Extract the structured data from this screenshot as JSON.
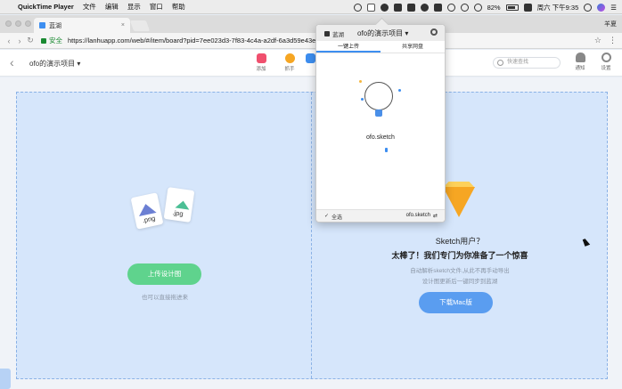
{
  "menubar": {
    "app_name": "QuickTime Player",
    "items": [
      "文件",
      "编辑",
      "显示",
      "窗口",
      "帮助"
    ],
    "battery": "82%",
    "clock": "周六 下午9:35",
    "apple_icon": "apple-icon"
  },
  "browser": {
    "tab_title": "蓝湖",
    "user_tag": "羊夏",
    "secure_label": "安全",
    "url": "https://lanhuapp.com/web/#/item/board?pid=7ee023d3-7f83-4c4a-a2df-6a3d59e43e"
  },
  "app": {
    "project_name": "ofo的演示项目",
    "tools": [
      {
        "label": "添加",
        "color": "#f0506e"
      },
      {
        "label": "抓手",
        "color": "#f6a623"
      }
    ],
    "search_placeholder": "快速查找",
    "notify_label": "通知",
    "settings_label": "设置"
  },
  "upload": {
    "file1_ext": ".png",
    "file2_ext": ".jpg",
    "upload_button": "上传设计图",
    "drag_hint": "也可以直接拖进来",
    "sketch_title": "Sketch用户？",
    "sketch_headline": "太棒了！我们专门为你准备了一个惊喜",
    "sketch_desc1": "自动解析sketch文件,从此不再手动导出",
    "sketch_desc2": "设计图更新后一键同步到蓝湖",
    "download_button": "下载Mac版"
  },
  "popup": {
    "brand": "蓝湖",
    "title": "ofo的演示项目",
    "tabs": [
      "一键上传",
      "共享网盘"
    ],
    "file_name": "ofo.sketch",
    "select_all": "全选",
    "footer_file": "ofo.sketch"
  }
}
